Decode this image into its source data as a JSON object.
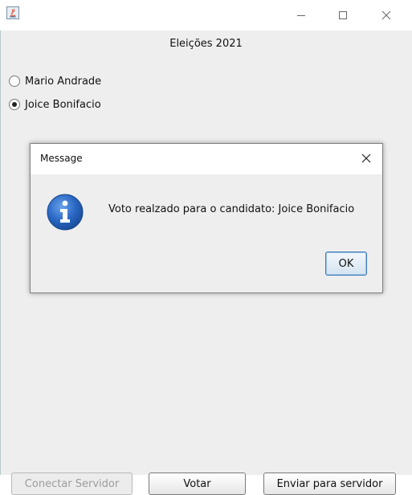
{
  "window": {
    "title": "",
    "header_title": "Eleições 2021",
    "controls": {
      "minimize_icon": "minimize-icon",
      "maximize_icon": "maximize-icon",
      "close_icon": "close-icon"
    }
  },
  "candidates": [
    {
      "label": "Mario Andrade",
      "selected": false
    },
    {
      "label": "Joice Bonifacio",
      "selected": true
    }
  ],
  "dialog": {
    "title": "Message",
    "icon": "info-icon",
    "message": "Voto realzado para o candidato: Joice Bonifacio",
    "ok_label": "OK"
  },
  "buttons": {
    "connect_label": "Conectar Servidor",
    "connect_enabled": false,
    "vote_label": "Votar",
    "send_label": "Enviar para servidor"
  },
  "colors": {
    "window_bg": "#eeeeee",
    "titlebar_bg": "#ffffff",
    "info_icon_blue": "#1f5fb8",
    "ok_button_border": "#3d7ab8"
  }
}
